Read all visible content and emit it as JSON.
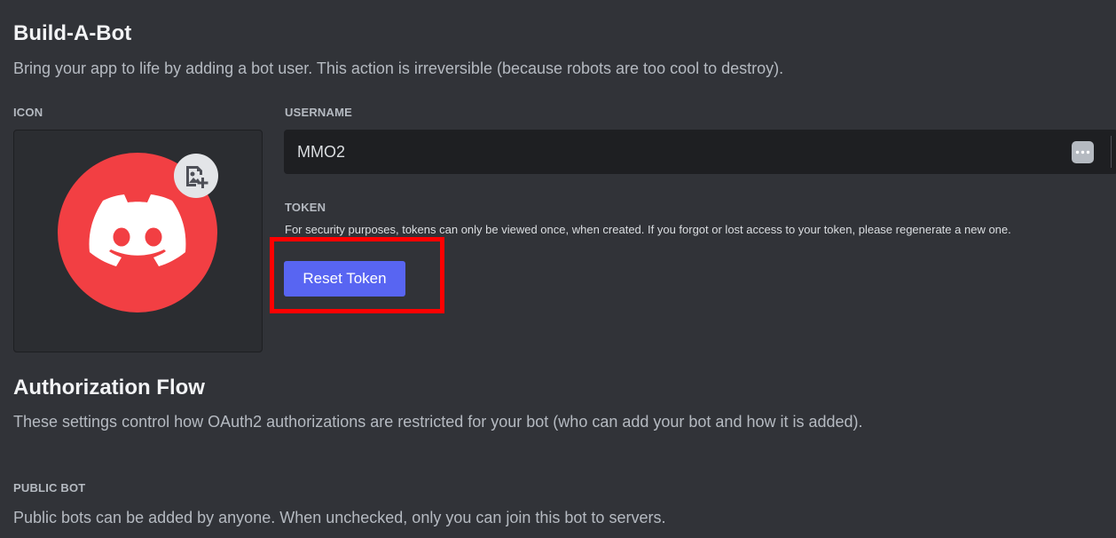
{
  "build_bot": {
    "title": "Build-A-Bot",
    "description": "Bring your app to life by adding a bot user. This action is irreversible (because robots are too cool to destroy).",
    "icon_label": "ICON",
    "icon_name": "discord-logo",
    "upload_icon_name": "image-plus-icon",
    "username_label": "USERNAME",
    "username_value": "MMO2",
    "token_label": "TOKEN",
    "token_description": "For security purposes, tokens can only be viewed once, when created. If you forgot or lost access to your token, please regenerate a new one.",
    "reset_button_label": "Reset Token"
  },
  "authorization_flow": {
    "title": "Authorization Flow",
    "description": "These settings control how OAuth2 authorizations are restricted for your bot (who can add your bot and how it is added).",
    "public_bot_label": "PUBLIC BOT",
    "public_bot_description": "Public bots can be added by anyone. When unchecked, only you can join this bot to servers."
  },
  "colors": {
    "background": "#313338",
    "avatar": "#f23f43",
    "button": "#5865f2",
    "highlight": "#ff0000"
  }
}
